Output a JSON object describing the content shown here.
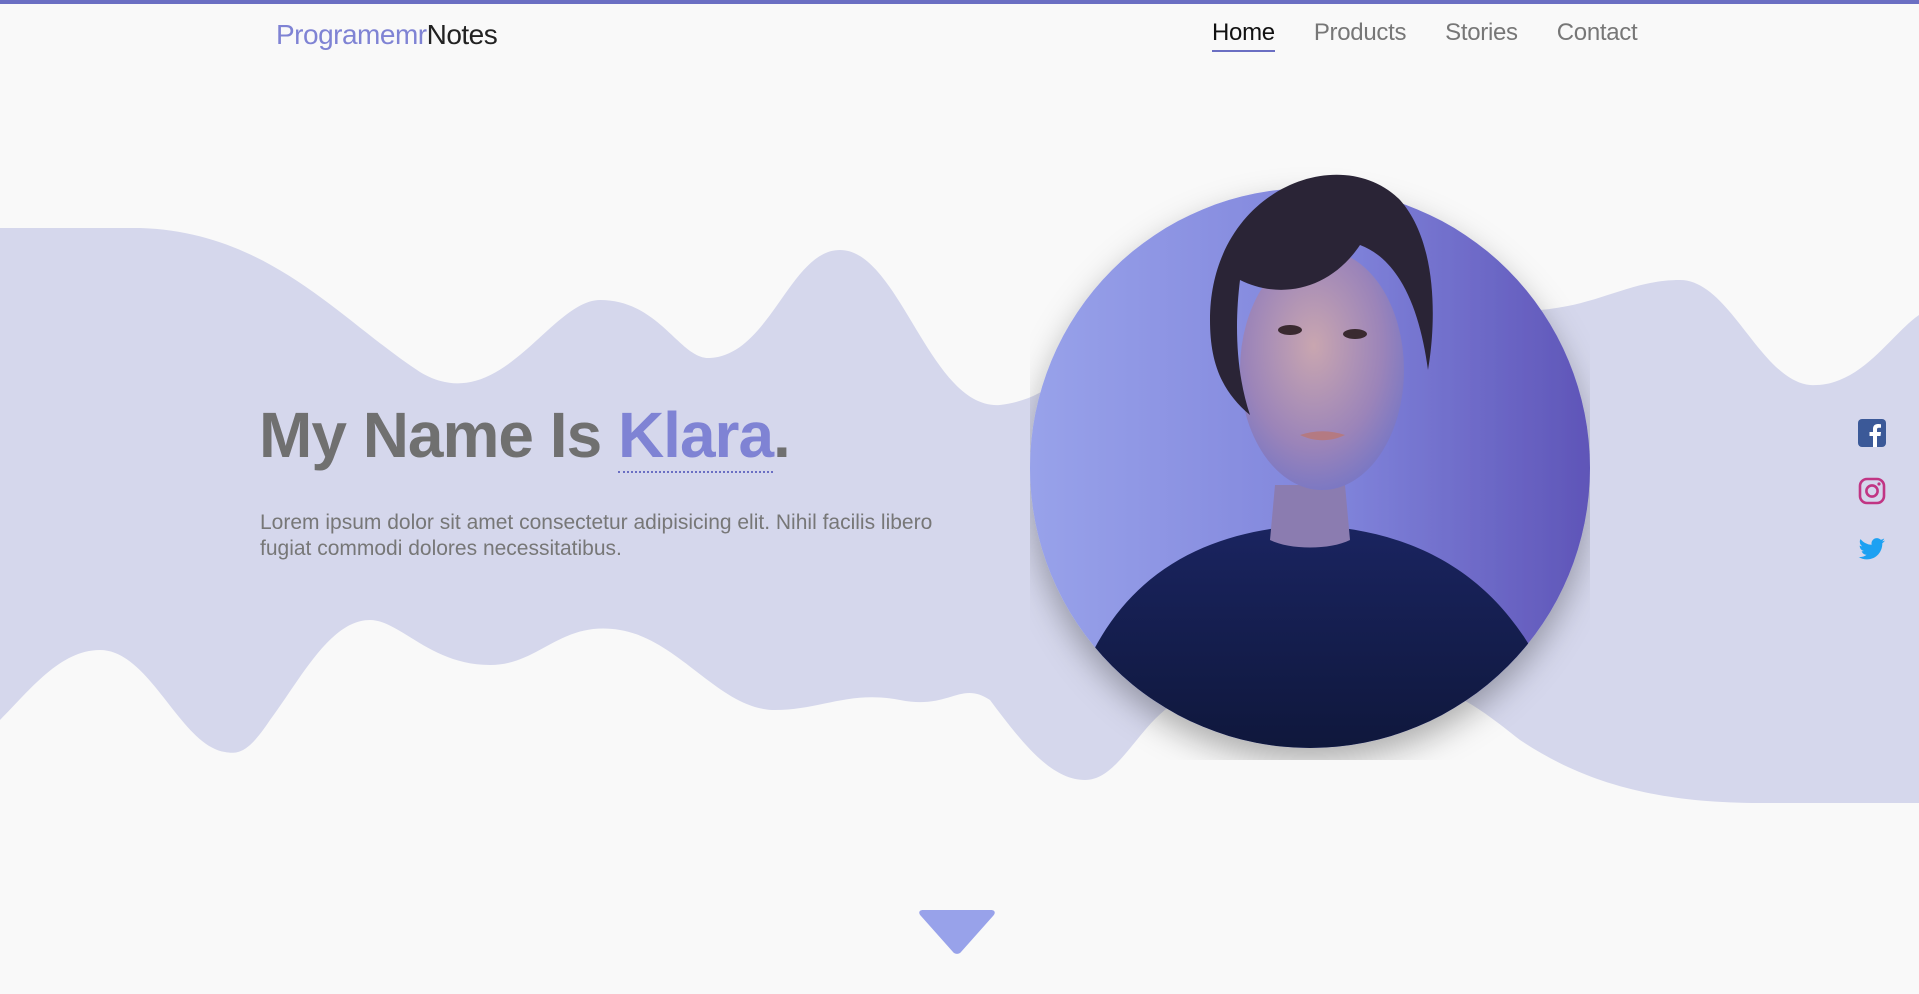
{
  "brand": {
    "accent": "Programemr",
    "rest": "Notes"
  },
  "nav": {
    "items": [
      {
        "label": "Home",
        "active": true
      },
      {
        "label": "Products",
        "active": false
      },
      {
        "label": "Stories",
        "active": false
      },
      {
        "label": "Contact",
        "active": false
      }
    ]
  },
  "hero": {
    "title_prefix": "My Name Is ",
    "title_name": "Klara",
    "title_suffix": ".",
    "description": "Lorem ipsum dolor sit amet consectetur adipisicing elit. Nihil facilis libero fugiat commodi dolores necessitatibus."
  },
  "social": [
    {
      "icon": "facebook-icon",
      "color": "#3b5998"
    },
    {
      "icon": "instagram-icon",
      "color": "#c13584"
    },
    {
      "icon": "twitter-icon",
      "color": "#1da1f2"
    }
  ],
  "scroll": {
    "icon": "triangle-down-icon"
  },
  "colors": {
    "accent": "#7f83d4",
    "accent_dark": "#6b6fc3",
    "wave": "#d5d7ec",
    "background": "#f9f9f9",
    "text": "#707070"
  }
}
